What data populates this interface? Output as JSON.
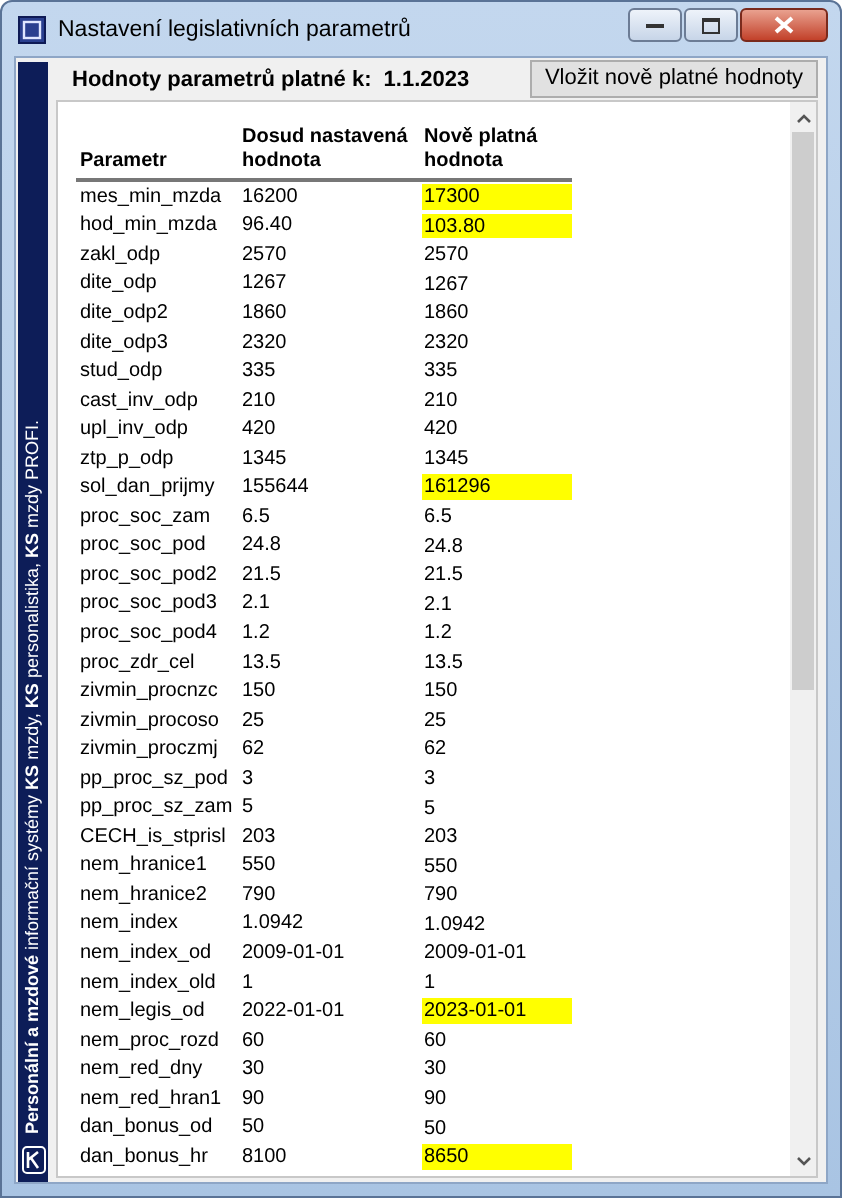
{
  "window": {
    "title": "Nastavení legislativních parametrů"
  },
  "sidebar": {
    "text": "**Personální a mzdové** informační systémy **KS** mzdy, **KS** personalistika, **KS** mzdy PROFI."
  },
  "header": {
    "label": "Hodnoty parametrů platné k:",
    "date": "1.1.2023",
    "button": "Vložit nově platné hodnoty"
  },
  "table": {
    "columns": [
      "Parametr",
      "Dosud nastavená hodnota",
      "Nově platná hodnota"
    ],
    "rows": [
      {
        "name": "mes_min_mzda",
        "old": "16200",
        "new": "17300",
        "changed": true
      },
      {
        "name": "hod_min_mzda",
        "old": "96.40",
        "new": "103.80",
        "changed": true
      },
      {
        "name": "zakl_odp",
        "old": "2570",
        "new": "2570",
        "changed": false
      },
      {
        "name": "dite_odp",
        "old": "1267",
        "new": "1267",
        "changed": false
      },
      {
        "name": "dite_odp2",
        "old": "1860",
        "new": "1860",
        "changed": false
      },
      {
        "name": "dite_odp3",
        "old": "2320",
        "new": "2320",
        "changed": false
      },
      {
        "name": "stud_odp",
        "old": "335",
        "new": "335",
        "changed": false
      },
      {
        "name": "cast_inv_odp",
        "old": "210",
        "new": "210",
        "changed": false
      },
      {
        "name": "upl_inv_odp",
        "old": "420",
        "new": "420",
        "changed": false
      },
      {
        "name": "ztp_p_odp",
        "old": "1345",
        "new": "1345",
        "changed": false
      },
      {
        "name": "sol_dan_prijmy",
        "old": "155644",
        "new": "161296",
        "changed": true
      },
      {
        "name": "proc_soc_zam",
        "old": "6.5",
        "new": "6.5",
        "changed": false
      },
      {
        "name": "proc_soc_pod",
        "old": "24.8",
        "new": "24.8",
        "changed": false
      },
      {
        "name": "proc_soc_pod2",
        "old": "21.5",
        "new": "21.5",
        "changed": false
      },
      {
        "name": "proc_soc_pod3",
        "old": "2.1",
        "new": "2.1",
        "changed": false
      },
      {
        "name": "proc_soc_pod4",
        "old": "1.2",
        "new": "1.2",
        "changed": false
      },
      {
        "name": "proc_zdr_cel",
        "old": "13.5",
        "new": "13.5",
        "changed": false
      },
      {
        "name": "zivmin_procnzc",
        "old": "150",
        "new": "150",
        "changed": false
      },
      {
        "name": "zivmin_procoso",
        "old": "25",
        "new": "25",
        "changed": false
      },
      {
        "name": "zivmin_proczmj",
        "old": "62",
        "new": "62",
        "changed": false
      },
      {
        "name": "pp_proc_sz_pod",
        "old": "3",
        "new": "3",
        "changed": false
      },
      {
        "name": "pp_proc_sz_zam",
        "old": "5",
        "new": "5",
        "changed": false
      },
      {
        "name": "CECH_is_stprisl",
        "old": "203",
        "new": "203",
        "changed": false
      },
      {
        "name": "nem_hranice1",
        "old": "550",
        "new": "550",
        "changed": false
      },
      {
        "name": "nem_hranice2",
        "old": "790",
        "new": "790",
        "changed": false
      },
      {
        "name": "nem_index",
        "old": "1.0942",
        "new": "1.0942",
        "changed": false
      },
      {
        "name": "nem_index_od",
        "old": "2009-01-01",
        "new": "2009-01-01",
        "changed": false
      },
      {
        "name": "nem_index_old",
        "old": "1",
        "new": "1",
        "changed": false
      },
      {
        "name": "nem_legis_od",
        "old": "2022-01-01",
        "new": "2023-01-01",
        "changed": true
      },
      {
        "name": "nem_proc_rozd",
        "old": "60",
        "new": "60",
        "changed": false
      },
      {
        "name": "nem_red_dny",
        "old": "30",
        "new": "30",
        "changed": false
      },
      {
        "name": "nem_red_hran1",
        "old": "90",
        "new": "90",
        "changed": false
      },
      {
        "name": "dan_bonus_od",
        "old": "50",
        "new": "50",
        "changed": false
      },
      {
        "name": "dan_bonus_hr",
        "old": "8100",
        "new": "8650",
        "changed": true
      }
    ]
  }
}
